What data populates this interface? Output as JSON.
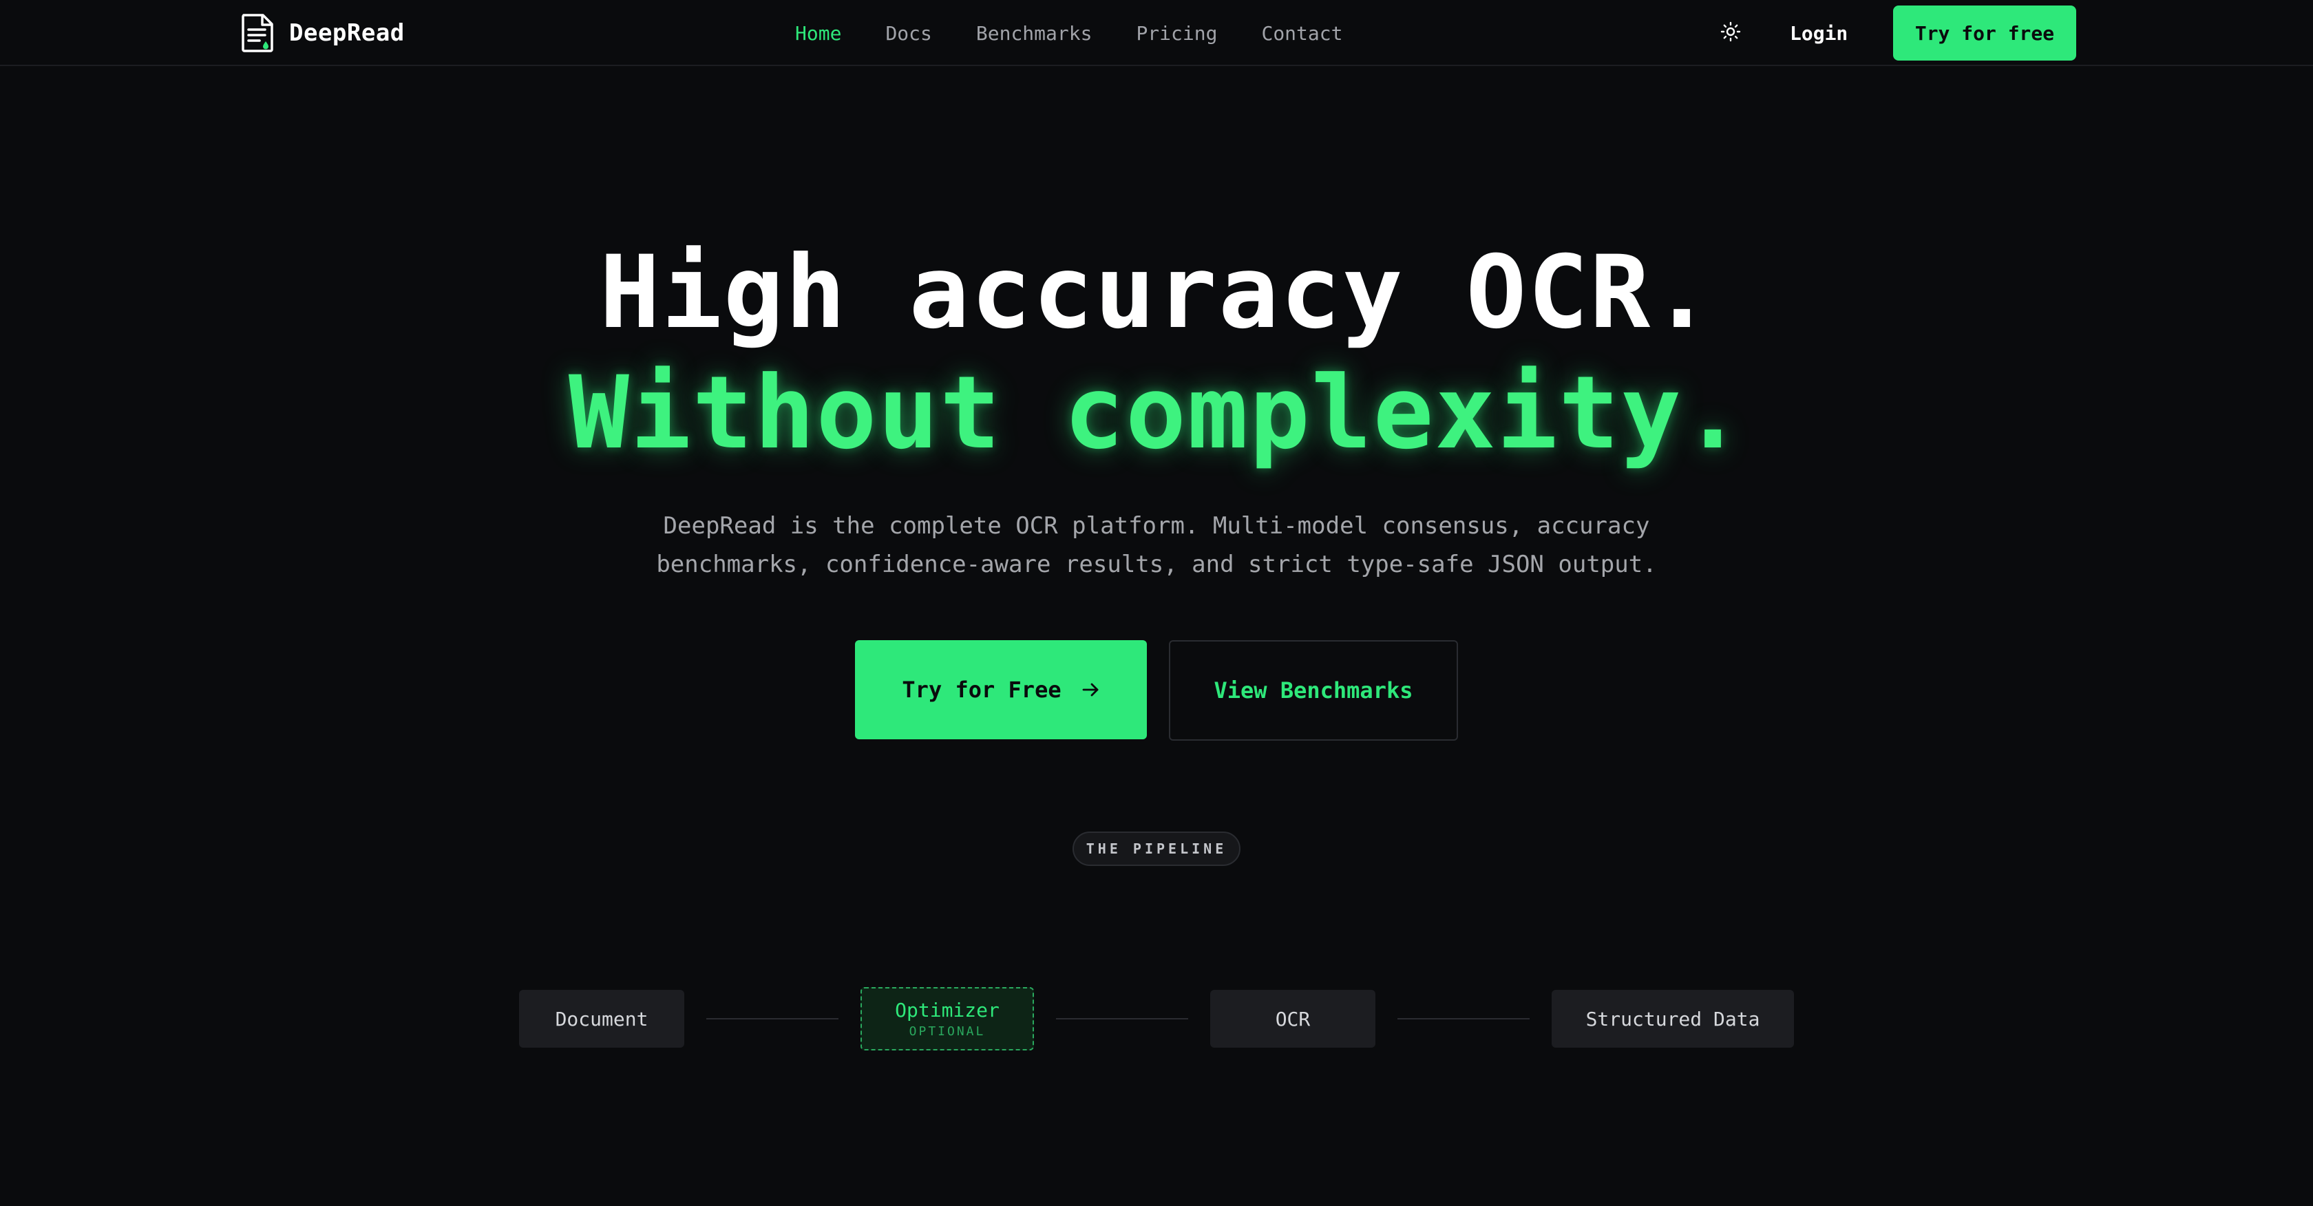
{
  "nav": {
    "brand": "DeepRead",
    "brand_icon": "document-icon",
    "links": [
      {
        "label": "Home",
        "active": true
      },
      {
        "label": "Docs",
        "active": false
      },
      {
        "label": "Benchmarks",
        "active": false
      },
      {
        "label": "Pricing",
        "active": false
      },
      {
        "label": "Contact",
        "active": false
      }
    ],
    "theme_icon": "sun-icon",
    "login": "Login",
    "cta": "Try for free"
  },
  "hero": {
    "title_line1": "High accuracy OCR.",
    "title_line2": "Without complexity.",
    "subtitle_line1": "DeepRead is the complete OCR platform. Multi-model consensus, accuracy",
    "subtitle_line2": "benchmarks, confidence-aware results, and strict type-safe JSON output.",
    "primary_button": "Try for Free",
    "primary_icon": "arrow-right-icon",
    "secondary_button": "View Benchmarks"
  },
  "pipeline": {
    "badge": "THE PIPELINE",
    "steps": [
      {
        "label": "Document"
      },
      {
        "label": "Optimizer",
        "tag": "OPTIONAL"
      },
      {
        "label": "OCR"
      },
      {
        "label": "Structured Data"
      }
    ]
  },
  "colors": {
    "background": "#0a0b0d",
    "accent": "#2ee87a",
    "muted_text": "#a4a6ab",
    "surface": "#1c1d21"
  }
}
